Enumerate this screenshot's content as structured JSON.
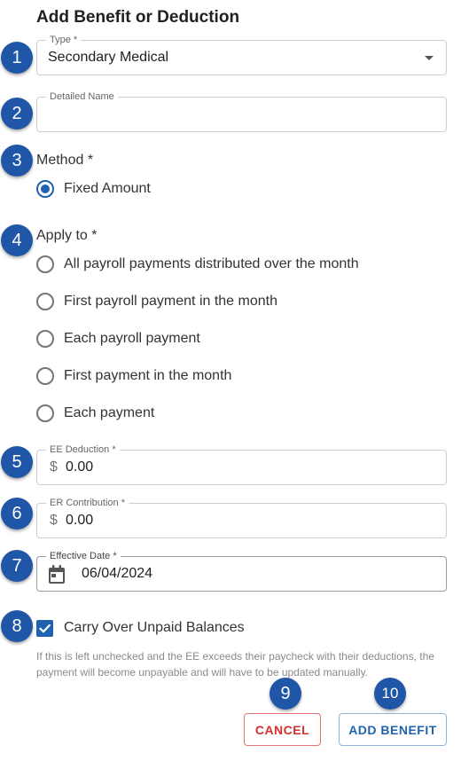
{
  "title": "Add Benefit or Deduction",
  "badges": [
    "1",
    "2",
    "3",
    "4",
    "5",
    "6",
    "7",
    "8",
    "9",
    "10"
  ],
  "type_field": {
    "legend": "Type *",
    "value": "Secondary Medical"
  },
  "detailed_name_field": {
    "legend": "Detailed Name",
    "value": ""
  },
  "method": {
    "label": "Method *",
    "options": [
      {
        "label": "Fixed Amount",
        "checked": true
      }
    ]
  },
  "apply_to": {
    "label": "Apply to *",
    "options": [
      {
        "label": "All payroll payments distributed over the month",
        "checked": false
      },
      {
        "label": "First payroll payment in the month",
        "checked": false
      },
      {
        "label": "Each payroll payment",
        "checked": false
      },
      {
        "label": "First payment in the month",
        "checked": false
      },
      {
        "label": "Each payment",
        "checked": false
      }
    ]
  },
  "ee_deduction": {
    "legend": "EE Deduction *",
    "prefix": "$",
    "value": "0.00"
  },
  "er_contribution": {
    "legend": "ER Contribution *",
    "prefix": "$",
    "value": "0.00"
  },
  "effective_date": {
    "legend": "Effective Date *",
    "value": "06/04/2024",
    "icon": "calendar-icon"
  },
  "carry_over": {
    "label": "Carry Over Unpaid Balances",
    "checked": true,
    "helper": "If this is left unchecked and the EE exceeds their paycheck with their deductions, the payment will become unpayable and will have to be updated manually."
  },
  "buttons": {
    "cancel": "CANCEL",
    "add": "ADD BENEFIT"
  },
  "colors": {
    "badge": "#1f56a8",
    "accent": "#1f63b0",
    "cancel": "#d32f2f"
  }
}
